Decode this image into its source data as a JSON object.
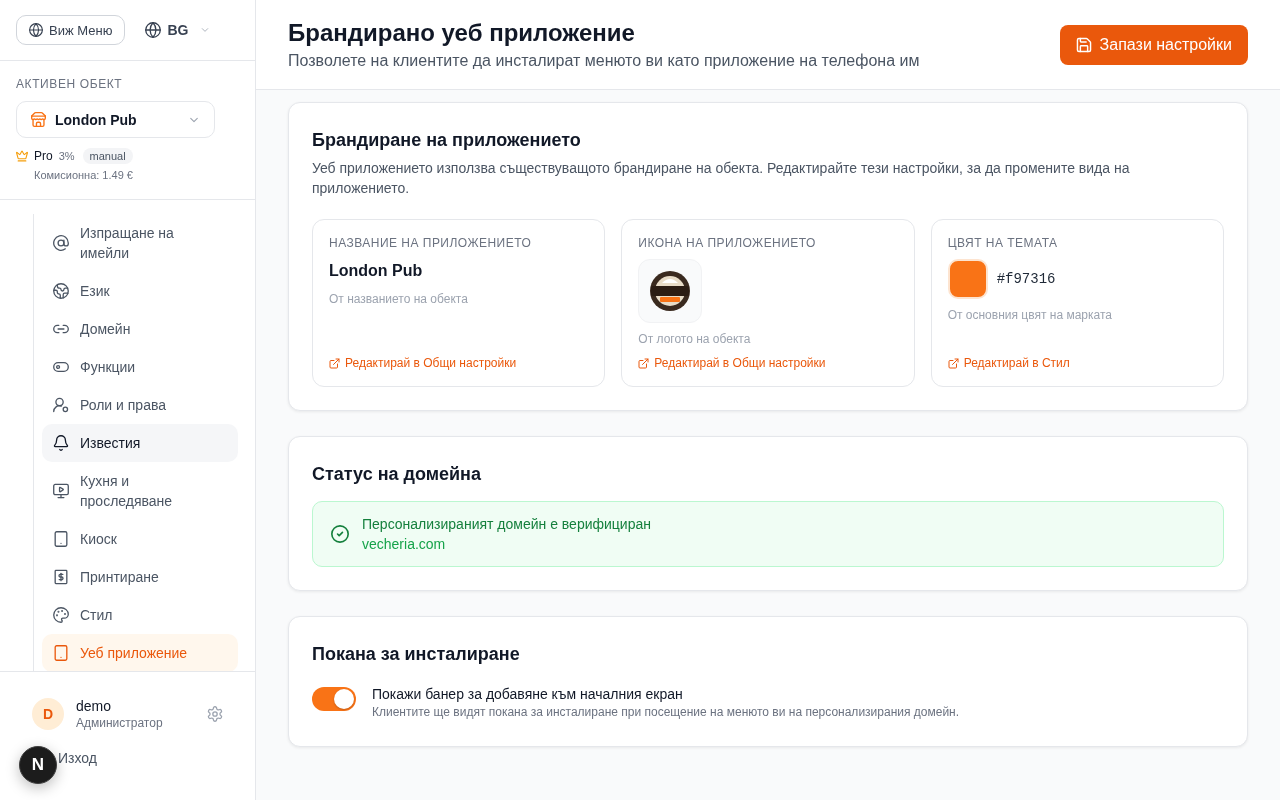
{
  "sidebar": {
    "view_menu_button": "Виж Меню",
    "language": "BG",
    "active_venue": {
      "label": "АКТИВЕН ОБЕКТ",
      "venue": "London Pub",
      "plan": "Pro",
      "rate": "3%",
      "mode": "manual",
      "commission": "Комисионна: 1.49 €"
    },
    "nav_items": [
      {
        "label": "Изпращане на имейли",
        "selected": false,
        "hovered": false
      },
      {
        "label": "Език",
        "selected": false,
        "hovered": false
      },
      {
        "label": "Домейн",
        "selected": false,
        "hovered": false
      },
      {
        "label": "Функции",
        "selected": false,
        "hovered": false
      },
      {
        "label": "Роли и права",
        "selected": false,
        "hovered": false
      },
      {
        "label": "Известия",
        "selected": false,
        "hovered": true
      },
      {
        "label": "Кухня и проследяване",
        "selected": false,
        "hovered": false
      },
      {
        "label": "Киоск",
        "selected": false,
        "hovered": false
      },
      {
        "label": "Принтиране",
        "selected": false,
        "hovered": false
      },
      {
        "label": "Стил",
        "selected": false,
        "hovered": false
      },
      {
        "label": "Уеб приложение",
        "selected": true,
        "hovered": false
      }
    ],
    "user": {
      "initial": "D",
      "name": "demo",
      "role": "Администратор"
    },
    "logout": "Изход"
  },
  "dev_badge": {
    "label": "N"
  },
  "header": {
    "title": "Брандирано уеб приложение",
    "subtitle": "Позволете на клиентите да инсталират менюто ви като приложение на телефона им",
    "save_button": "Запази настройки"
  },
  "branding_card": {
    "title": "Брандиране на приложението",
    "description": "Уеб приложението използва съществуващото брандиране на обекта. Редактирайте тези настройки, за да промените вида на приложението.",
    "tiles": [
      {
        "kind": "name",
        "label": "НАЗВАНИЕ НА ПРИЛОЖЕНИЕТО",
        "value": "London Pub",
        "note": "От названието на обекта",
        "link": "Редактирай в Общи настройки"
      },
      {
        "kind": "icon",
        "label": "ИКОНА НА ПРИЛОЖЕНИЕТО",
        "note": "От логото на обекта",
        "link": "Редактирай в Общи настройки"
      },
      {
        "kind": "color",
        "label": "ЦВЯТ НА ТЕМАТА",
        "value": "#f97316",
        "color": "#f97316",
        "note": "От основния цвят на марката",
        "link": "Редактирай в Стил"
      }
    ]
  },
  "domain_card": {
    "title": "Статус на домейна",
    "status": {
      "verified": true,
      "message": "Персонализираният домейн е верифициран",
      "domain": "vecheria.com"
    }
  },
  "install_card": {
    "title": "Покана за инсталиране",
    "toggle": {
      "on": true,
      "label": "Покажи банер за добавяне към началния екран",
      "description": "Клиентите ще видят покана за инсталиране при посещение на менюто ви на персонализирания домейн."
    }
  }
}
